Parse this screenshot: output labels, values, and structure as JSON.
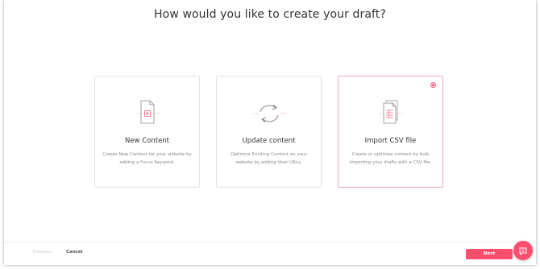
{
  "title": "How would you like to create your draft?",
  "options": [
    {
      "title": "New Content",
      "description": "Create New Content for your website by adding a Focus Keyword.",
      "icon": "new-document-icon",
      "selected": false
    },
    {
      "title": "Update content",
      "description": "Optimize Existing Content on your website by adding their URLs.",
      "icon": "refresh-icon",
      "selected": false
    },
    {
      "title": "Import CSV file",
      "description": "Create or optimize content by bulk importing your drafts with a CSV file.",
      "icon": "csv-document-icon",
      "selected": true
    }
  ],
  "footer": {
    "previous_label": "Previous",
    "cancel_label": "Cancel",
    "next_label": "Next"
  },
  "chat": {
    "icon": "chat-icon"
  },
  "colors": {
    "accent": "#ff4d6d",
    "selected_border": "#f2a7b3",
    "icon_stroke": "#888888"
  }
}
